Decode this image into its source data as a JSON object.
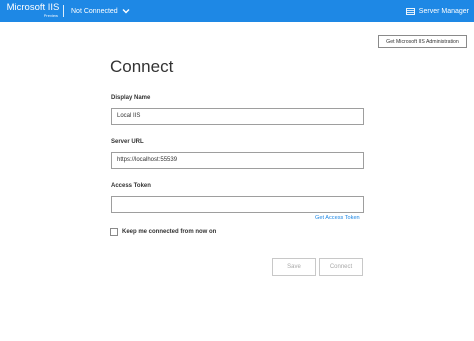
{
  "app": {
    "title": "Microsoft IIS",
    "subtitle": "Preview",
    "connection_status": "Not Connected",
    "server_manager_label": "Server Manager"
  },
  "colors": {
    "accent": "#1e88e5",
    "link": "#1e88e5"
  },
  "header_button": {
    "label": "Get Microsoft IIS Administration"
  },
  "form": {
    "title": "Connect",
    "display_name": {
      "label": "Display Name",
      "value": "Local IIS"
    },
    "server_url": {
      "label": "Server URL",
      "value": "https://localhost:55539"
    },
    "access_token": {
      "label": "Access Token",
      "value": "",
      "link": "Get Access Token"
    },
    "keep_connected": {
      "label": "Keep me connected from now on",
      "checked": false
    },
    "save_label": "Save",
    "connect_label": "Connect"
  },
  "icons": {
    "chevron": "chevron-down-icon",
    "server_manager": "server-manager-icon"
  }
}
